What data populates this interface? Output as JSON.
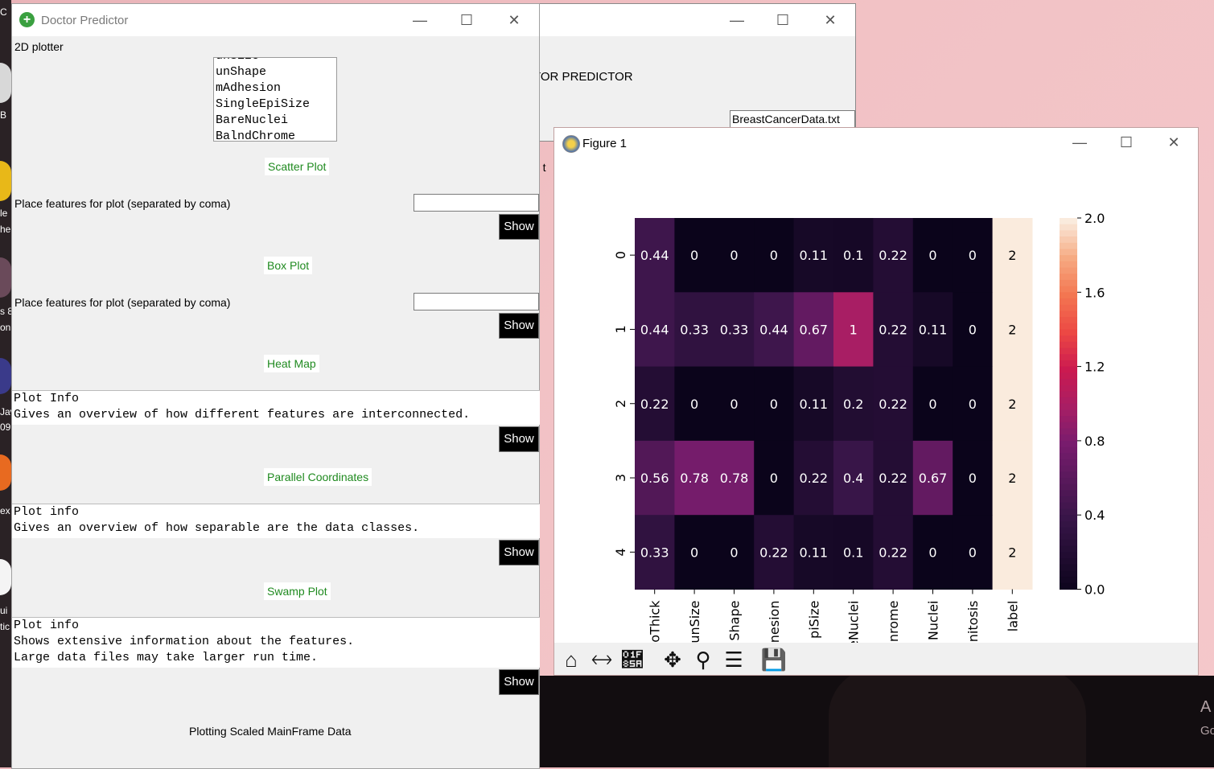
{
  "main_window": {
    "title": "Doctor Predictor",
    "heading": "2D plotter",
    "feature_list": [
      "unSize",
      "unShape",
      "mAdhesion",
      "SingleEpiSize",
      "BareNuclei",
      "BalndChrome"
    ],
    "scatter": {
      "button": "Scatter Plot",
      "prompt": "Place features for plot (separated by coma)",
      "input_value": "",
      "show": "Show"
    },
    "box": {
      "button": "Box Plot",
      "prompt": "Place features for plot (separated by coma)",
      "input_value": "",
      "show": "Show"
    },
    "heatmap": {
      "button": "Heat Map",
      "info_line1": "Plot Info",
      "info_line2": "Gives an overview of how different features are interconnected.",
      "show": "Show"
    },
    "parallel": {
      "button": "Parallel Coordinates",
      "info_line1": "Plot info",
      "info_line2": "Gives an overview of how separable are the data classes.",
      "show": "Show"
    },
    "swamp": {
      "button": "Swamp Plot",
      "info_line1": "Plot info",
      "info_line2": "Shows extensive information about the features.",
      "info_line3": "Large data files may take larger run time.",
      "show": "Show"
    },
    "footer": "Plotting Scaled MainFrame Data"
  },
  "back_window": {
    "heading_fragment": "TOR PREDICTOR",
    "file_field": "BreastCancerData.txt",
    "side_fragment": "a t"
  },
  "figure_window": {
    "title": "Figure 1",
    "toolbar_icons": [
      "home-icon",
      "back-arrow-icon",
      "forward-arrow-icon",
      "pan-icon",
      "zoom-icon",
      "configure-icon",
      "save-icon"
    ]
  },
  "chart_data": {
    "type": "heatmap",
    "row_labels": [
      "0",
      "1",
      "2",
      "3",
      "4"
    ],
    "col_labels": [
      "oThick",
      "unSize",
      "Shape",
      "nesion",
      "piSize",
      "eNuclei",
      "nrome",
      "Nuclei",
      "nitosis",
      "label"
    ],
    "values": [
      [
        0.44,
        0,
        0,
        0,
        0.11,
        0.1,
        0.22,
        0,
        0,
        2
      ],
      [
        0.44,
        0.33,
        0.33,
        0.44,
        0.67,
        1,
        0.22,
        0.11,
        0,
        2
      ],
      [
        0.22,
        0,
        0,
        0,
        0.11,
        0.2,
        0.22,
        0,
        0,
        2
      ],
      [
        0.56,
        0.78,
        0.78,
        0,
        0.22,
        0.4,
        0.22,
        0.67,
        0,
        2
      ],
      [
        0.33,
        0,
        0,
        0.22,
        0.11,
        0.1,
        0.22,
        0,
        0,
        2
      ]
    ],
    "annotations": [
      [
        "0.44",
        "0",
        "0",
        "0",
        "0.11",
        "0.1",
        "0.22",
        "0",
        "0",
        "2"
      ],
      [
        "0.44",
        "0.33",
        "0.33",
        "0.44",
        "0.67",
        "1",
        "0.22",
        "0.11",
        "0",
        "2"
      ],
      [
        "0.22",
        "0",
        "0",
        "0",
        "0.11",
        "0.2",
        "0.22",
        "0",
        "0",
        "2"
      ],
      [
        "0.56",
        "0.78",
        "0.78",
        "0",
        "0.22",
        "0.4",
        "0.22",
        "0.67",
        "0",
        "2"
      ],
      [
        "0.33",
        "0",
        "0",
        "0.22",
        "0.11",
        "0.1",
        "0.22",
        "0",
        "0",
        "2"
      ]
    ],
    "colorbar_ticks": [
      "0.0",
      "0.4",
      "0.8",
      "1.2",
      "1.6",
      "2.0"
    ],
    "vmin": 0,
    "vmax": 2,
    "colormap": "rocket"
  },
  "desktop": {
    "icon_fragments": [
      "C",
      "B",
      "le",
      "he",
      "s 8",
      "on",
      "Jav",
      "09",
      "ex",
      "ui",
      "tic"
    ],
    "activation_lines": [
      "A",
      "Go"
    ]
  }
}
